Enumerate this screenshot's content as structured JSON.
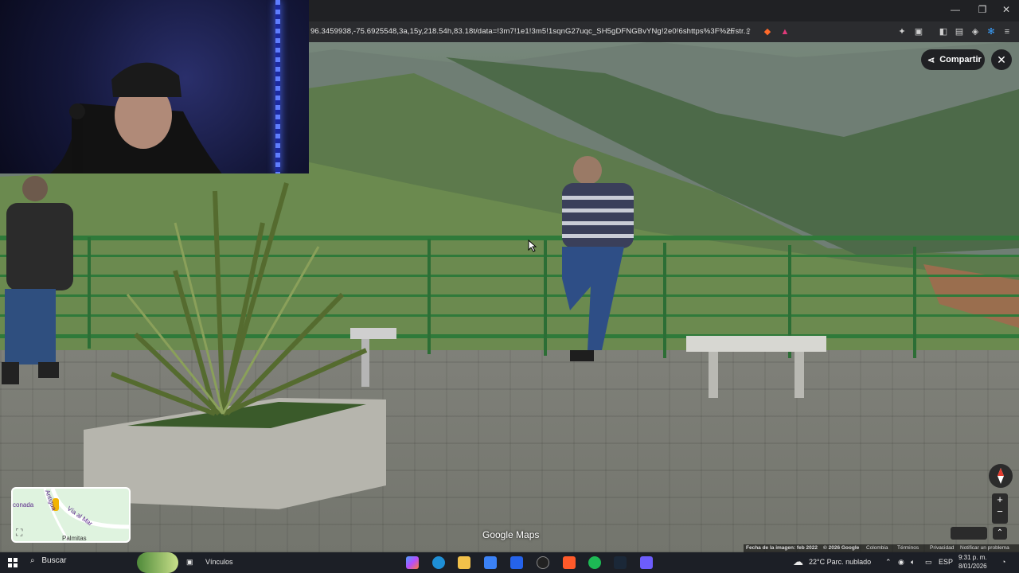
{
  "browser": {
    "url": "96.3459938,-75.6925548,3a,15y,218.54h,83.18t/data=!3m7!1e1!3m5!1sqnG27uqc_SH5gDFNGBvYNg!2e0!6shttps%3F%2Fstr..."
  },
  "streetview": {
    "share_label": "Compartir",
    "close_icon": "close-icon",
    "watermark": "Google Maps",
    "minimap": {
      "labels": [
        "conada",
        "Vía al Mar",
        "Palmitas",
        "Antigua"
      ]
    },
    "footer": {
      "image_date": "Fecha de la imagen: feb 2022",
      "copyright": "© 2026 Google",
      "country": "Colombia",
      "terms": "Términos",
      "privacy": "Privacidad",
      "report": "Notificar un problema"
    }
  },
  "taskbar": {
    "search_placeholder": "Buscar",
    "links_label": "Vínculos",
    "weather": "22°C  Parc. nublado",
    "lang": "ESP",
    "time": "9:31 p. m.",
    "date": "8/01/2026"
  },
  "colors": {
    "rail": "#2f7a3a",
    "led": "#5f7dff",
    "taskbar": "#1c1f26"
  }
}
